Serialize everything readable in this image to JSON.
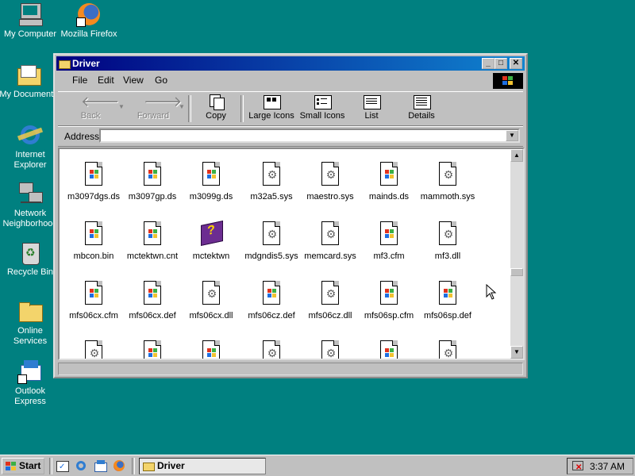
{
  "desktop": {
    "icons": [
      {
        "label": "My Computer",
        "icon": "computer-icon"
      },
      {
        "label": "Mozilla Firefox",
        "icon": "firefox-icon"
      },
      {
        "label": "My Documents",
        "icon": "folder-icon"
      },
      {
        "label": "Internet Explorer",
        "icon": "ie-icon"
      },
      {
        "label": "Network Neighborhood",
        "icon": "network-icon"
      },
      {
        "label": "Recycle Bin",
        "icon": "recycle-bin-icon"
      },
      {
        "label": "Online Services",
        "icon": "folder-icon"
      },
      {
        "label": "Outlook Express",
        "icon": "outlook-icon"
      }
    ]
  },
  "window": {
    "title": "Driver",
    "menu": [
      "File",
      "Edit",
      "View",
      "Go"
    ],
    "toolbar": {
      "back": "Back",
      "forward": "Forward",
      "copy": "Copy",
      "large_icons": "Large Icons",
      "small_icons": "Small Icons",
      "list": "List",
      "details": "Details"
    },
    "address_label": "Address",
    "address_value": "",
    "files": [
      {
        "name": "m3097dgs.ds",
        "icon": "win-file-icon"
      },
      {
        "name": "m3097gp.ds",
        "icon": "win-file-icon"
      },
      {
        "name": "m3099g.ds",
        "icon": "win-file-icon"
      },
      {
        "name": "m32a5.sys",
        "icon": "system-file-icon"
      },
      {
        "name": "maestro.sys",
        "icon": "system-file-icon"
      },
      {
        "name": "mainds.ds",
        "icon": "win-file-icon"
      },
      {
        "name": "mammoth.sys",
        "icon": "system-file-icon"
      },
      {
        "name": "mbcon.bin",
        "icon": "win-file-icon"
      },
      {
        "name": "mctektwn.cnt",
        "icon": "win-file-icon"
      },
      {
        "name": "mctektwn",
        "icon": "help-book-icon"
      },
      {
        "name": "mdgndis5.sys",
        "icon": "system-file-icon"
      },
      {
        "name": "memcard.sys",
        "icon": "system-file-icon"
      },
      {
        "name": "mf3.cfm",
        "icon": "win-file-icon"
      },
      {
        "name": "mf3.dll",
        "icon": "system-file-icon"
      },
      {
        "name": "mfs06cx.cfm",
        "icon": "win-file-icon"
      },
      {
        "name": "mfs06cx.def",
        "icon": "win-file-icon"
      },
      {
        "name": "mfs06cx.dll",
        "icon": "system-file-icon"
      },
      {
        "name": "mfs06cz.def",
        "icon": "win-file-icon"
      },
      {
        "name": "mfs06cz.dll",
        "icon": "system-file-icon"
      },
      {
        "name": "mfs06sp.cfm",
        "icon": "win-file-icon"
      },
      {
        "name": "mfs06sp.def",
        "icon": "win-file-icon"
      },
      {
        "name": "",
        "icon": "system-file-icon"
      },
      {
        "name": "",
        "icon": "win-file-icon"
      },
      {
        "name": "",
        "icon": "win-file-icon"
      },
      {
        "name": "",
        "icon": "system-file-icon"
      },
      {
        "name": "",
        "icon": "system-file-icon"
      },
      {
        "name": "",
        "icon": "win-file-icon"
      },
      {
        "name": "",
        "icon": "system-file-icon"
      }
    ]
  },
  "taskbar": {
    "start_label": "Start",
    "task_label": "Driver",
    "clock": "3:37 AM"
  }
}
